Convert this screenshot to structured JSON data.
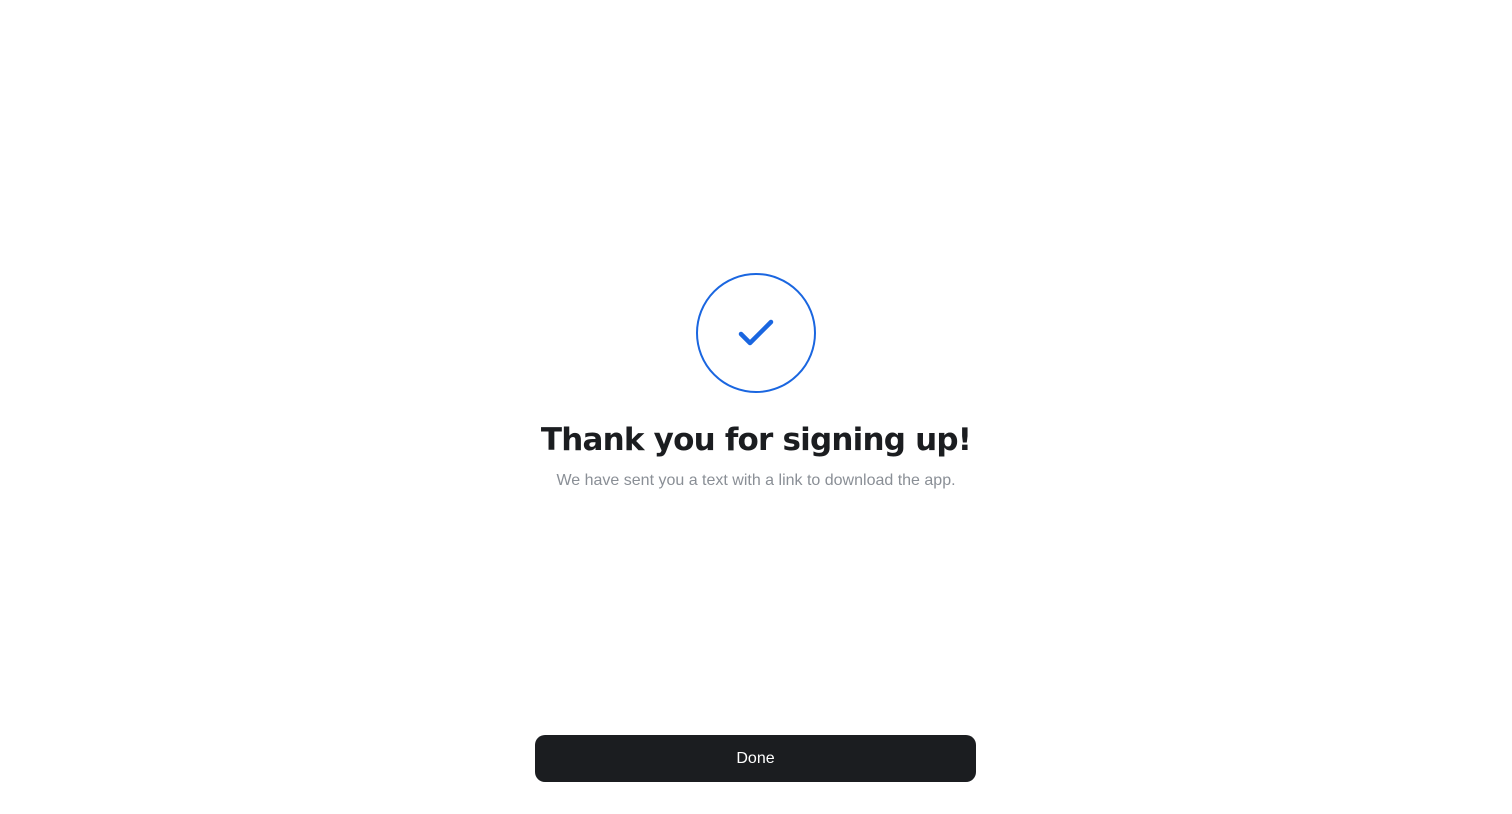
{
  "confirmation": {
    "icon": "checkmark-icon",
    "accent_color": "#1a66e0",
    "title": "Thank you for signing up!",
    "message": "We have sent you a text with a link to download the app."
  },
  "actions": {
    "done_label": "Done",
    "button_color": "#1b1d20"
  }
}
